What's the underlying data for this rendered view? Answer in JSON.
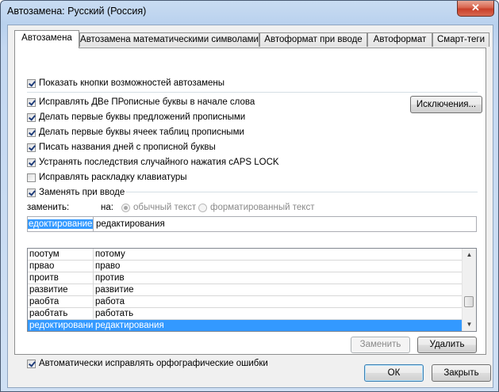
{
  "window": {
    "title": "Автозамена: Русский (Россия)",
    "close_glyph": "✕"
  },
  "tabs": [
    {
      "label": "Автозамена",
      "active": true
    },
    {
      "label": "Автозамена математическими символами",
      "active": false
    },
    {
      "label": "Автоформат при вводе",
      "active": false
    },
    {
      "label": "Автоформат",
      "active": false
    },
    {
      "label": "Смарт-теги",
      "active": false
    }
  ],
  "options": {
    "show_buttons": {
      "label": "Показать кнопки возможностей автозамены",
      "checked": true
    },
    "two_caps": {
      "label": "Исправлять ДВе ПРописные буквы в начале слова",
      "checked": true
    },
    "first_sentence": {
      "label": "Делать первые буквы предложений прописными",
      "checked": true
    },
    "first_cell": {
      "label": "Делать первые буквы ячеек таблиц прописными",
      "checked": true
    },
    "day_names": {
      "label": "Писать названия дней с прописной буквы",
      "checked": true
    },
    "caps_lock": {
      "label": "Устранять последствия случайного нажатия cAPS LOCK",
      "checked": true
    },
    "keyboard": {
      "label": "Исправлять раскладку клавиатуры",
      "checked": false
    },
    "replace_typing": {
      "label": "Заменять при вводе",
      "checked": true
    },
    "auto_spell": {
      "label": "Автоматически исправлять орфографические ошибки",
      "checked": true
    }
  },
  "exceptions_button": "Исключения...",
  "replace_label": "заменить:",
  "with_label": "на:",
  "radio_plain": "обычный текст",
  "radio_formatted": "форматированный текст",
  "replace_value": "едоктирование",
  "with_value": "редактирования",
  "table": [
    {
      "from": "поотум",
      "to": "потому",
      "selected": false
    },
    {
      "from": "првао",
      "to": "право",
      "selected": false
    },
    {
      "from": "проитв",
      "to": "против",
      "selected": false
    },
    {
      "from": "развитие",
      "to": "развитие",
      "selected": false
    },
    {
      "from": "раобта",
      "to": "работа",
      "selected": false
    },
    {
      "from": "раобтать",
      "to": "работать",
      "selected": false
    },
    {
      "from": "редоктировани",
      "to": "редактирования",
      "selected": true
    }
  ],
  "scroll": {
    "up": "▲",
    "down": "▼"
  },
  "replace_button": "Заменить",
  "delete_button": "Удалить",
  "ok_button": "ОК",
  "close_button": "Закрыть"
}
